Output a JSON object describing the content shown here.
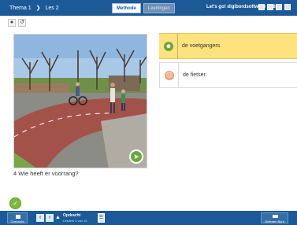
{
  "topbar": {
    "breadcrumb": [
      "Thema 1",
      "Les 2"
    ],
    "tabs": [
      "Methode",
      "Leerlingen"
    ],
    "app_title": "Let's go! digibordsoftware gr 8",
    "icons": [
      "help-icon",
      "settings-icon",
      "minimize-icon",
      "close-icon"
    ]
  },
  "toolbar": {
    "icons": [
      "record-icon",
      "refresh-icon"
    ]
  },
  "exercise": {
    "options": [
      {
        "label": "de voetgangers",
        "state": "correct"
      },
      {
        "label": "de fietser",
        "state": "unselected"
      }
    ],
    "question": "4 Wie heeft er voorrang?"
  },
  "bottombar": {
    "home_label": "Overzicht",
    "task_title": "Opdracht",
    "task_subtitle": "Lesdeel 4 van 10",
    "right_label": "Oefenen Bord"
  },
  "colors": {
    "bar": "#1b5a97",
    "selected_option": "#fde27e",
    "correct": "#6aa83b",
    "incorrect": "#f0a27a"
  }
}
